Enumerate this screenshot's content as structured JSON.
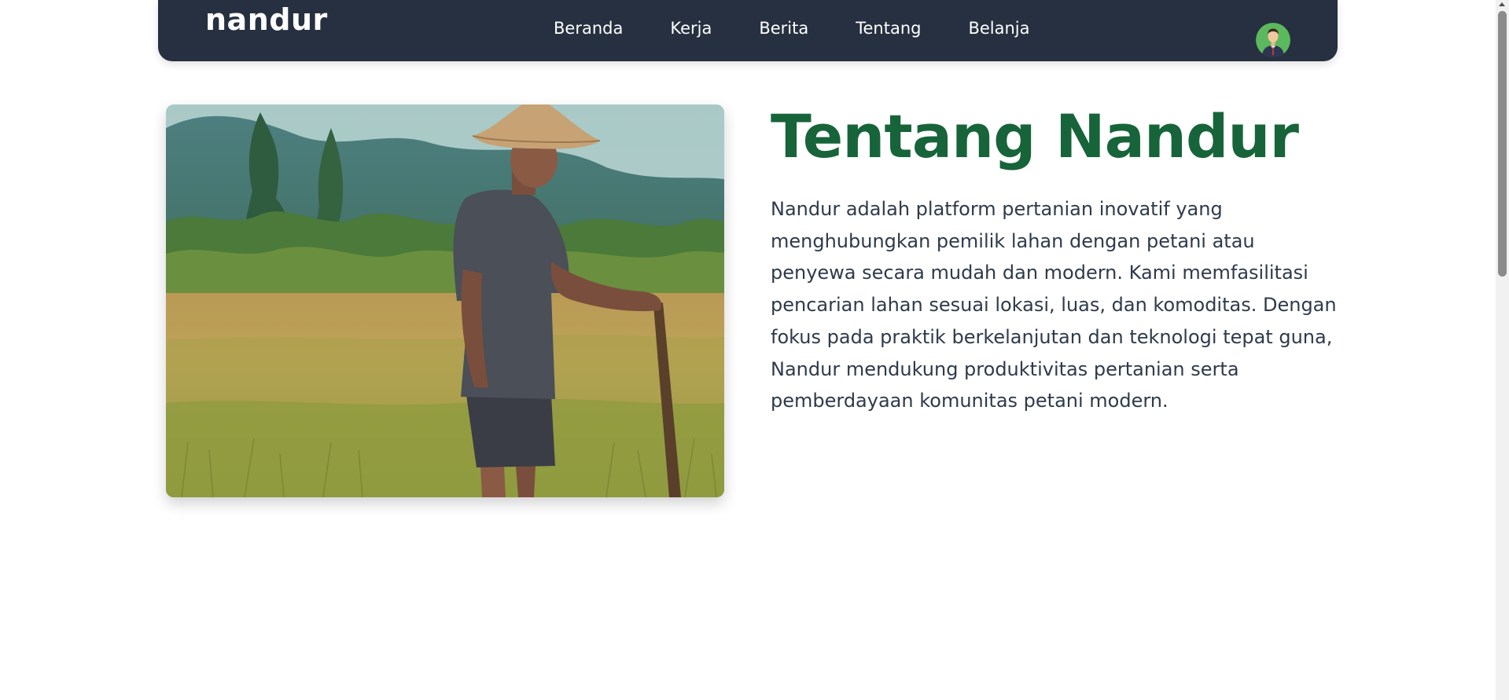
{
  "navbar": {
    "brand": "nandur",
    "links": [
      "Beranda",
      "Kerja",
      "Berita",
      "Tentang",
      "Belanja"
    ]
  },
  "about": {
    "title": "Tentang Nandur",
    "description": "Nandur adalah platform pertanian inovatif yang menghubungkan pemilik lahan dengan petani atau penyewa secara mudah dan modern. Kami memfasilitasi pencarian lahan sesuai lokasi, luas, dan komoditas. Dengan fokus pada praktik berkelanjutan dan teknologi tepat guna, Nandur mendukung produktivitas pertanian serta pemberdayaan komunitas petani modern."
  },
  "colors": {
    "navbar_bg": "#263040",
    "title": "#17643a",
    "body_text": "#2f3a4b"
  }
}
